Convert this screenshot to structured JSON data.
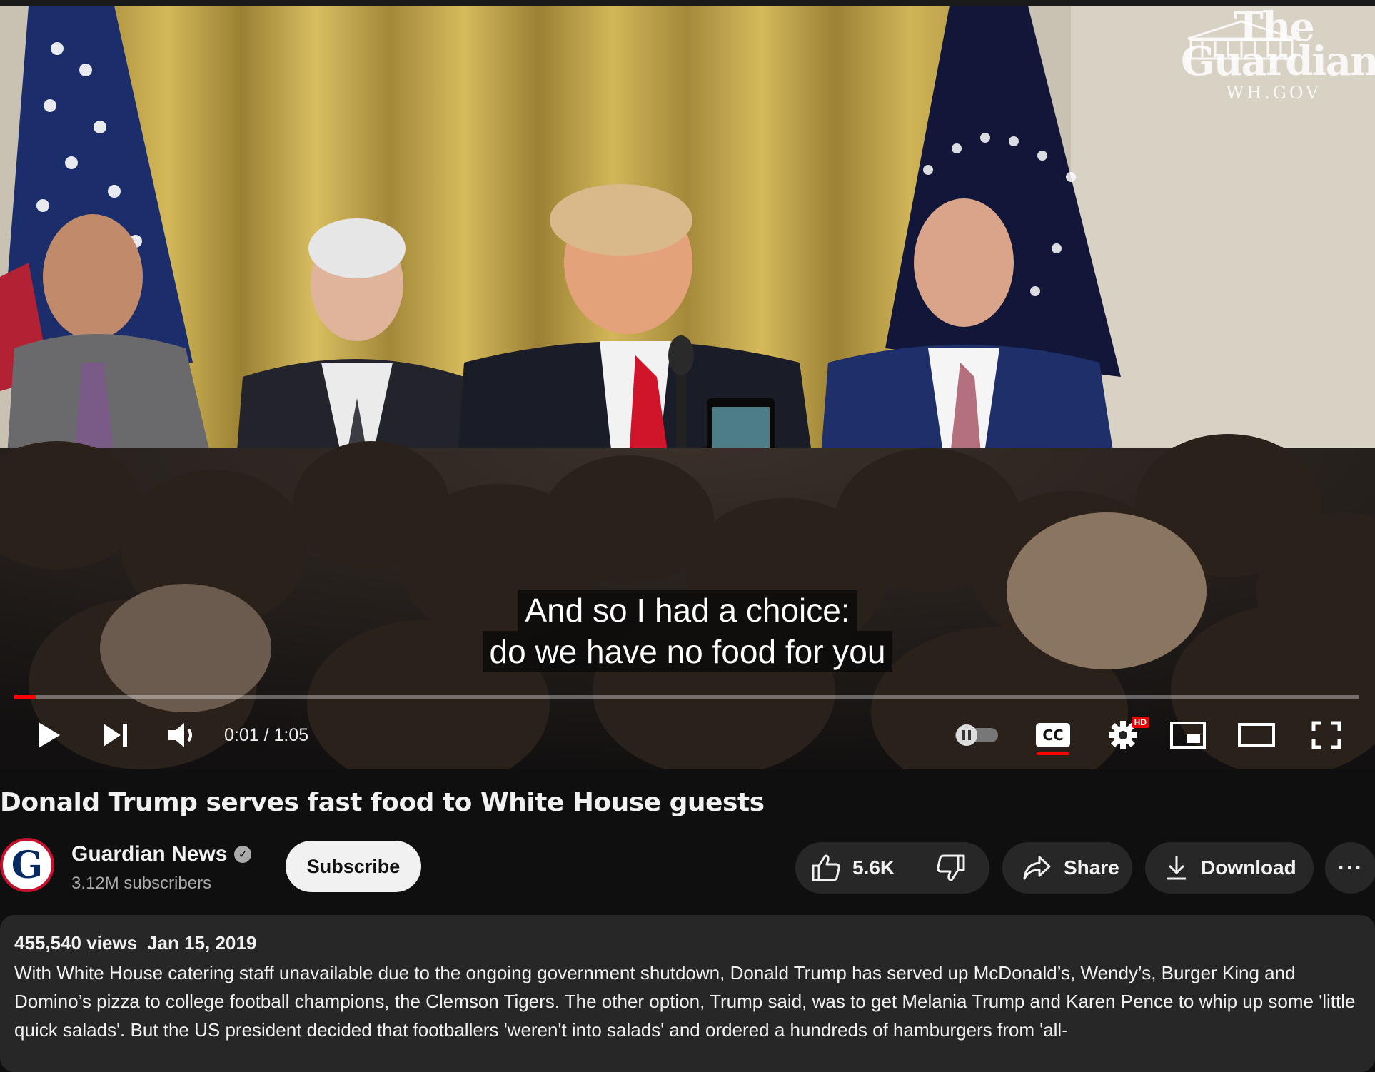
{
  "video": {
    "watermark_line1": "The",
    "watermark_line2": "Guardian",
    "watermark_url": "WH.GOV",
    "caption_line1": "And so I had a choice:",
    "caption_line2": "do we have no food for you",
    "progress_fraction": 0.016,
    "time_display": "0:01 / 1:05",
    "hd_badge": "HD",
    "cc_label": "CC",
    "icons": [
      "play-icon",
      "next-icon",
      "volume-icon",
      "autoplay-toggle-icon",
      "captions-icon",
      "settings-icon",
      "miniplayer-icon",
      "theater-icon",
      "fullscreen-icon"
    ]
  },
  "title": "Donald Trump serves fast food to White House guests",
  "channel": {
    "avatar_letter": "G",
    "name": "Guardian News",
    "verified_mark": "✓",
    "subscribers": "3.12M subscribers",
    "subscribe_label": "Subscribe"
  },
  "actions": {
    "likes": "5.6K",
    "share_label": "Share",
    "download_label": "Download",
    "more_label": "···"
  },
  "description": {
    "views": "455,540 views",
    "date": "Jan 15, 2019",
    "text": "With White House catering staff unavailable due to the ongoing government shutdown, Donald Trump has served up McDonald’s, Wendy’s, Burger King and Domino’s pizza to college football champions, the Clemson Tigers.  The other option, Trump said, was to get Melania Trump and Karen Pence to whip up some 'little quick salads'. But the US president decided that footballers 'weren't into salads' and ordered a hundreds of hamburgers from 'all-"
  },
  "colors": {
    "progress_red": "#ff0000",
    "background": "#0f0f0f",
    "surface": "#272727",
    "guardian_blue": "#052962"
  }
}
